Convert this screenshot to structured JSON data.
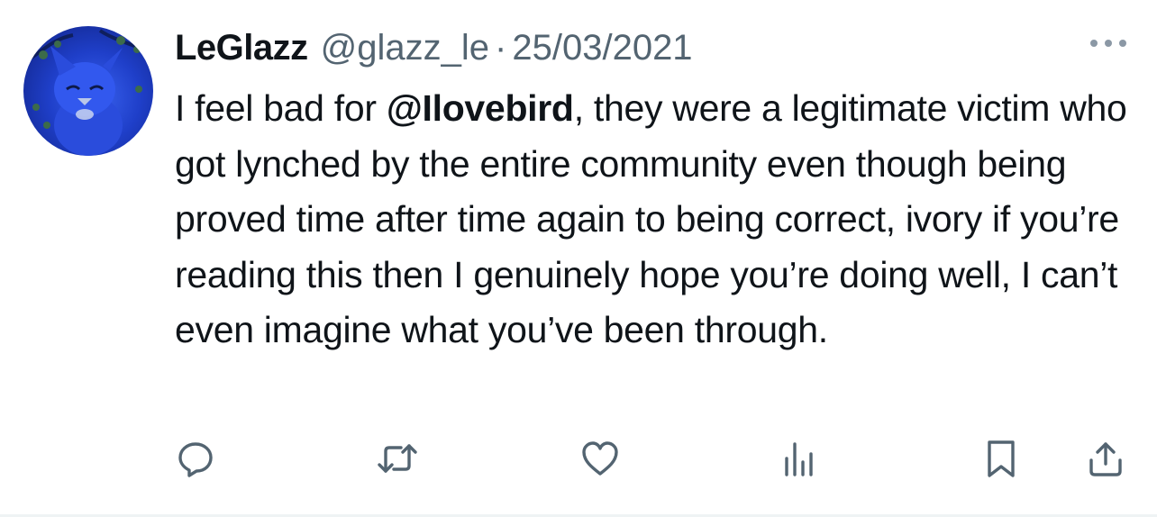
{
  "tweet": {
    "author_name": "LeGlazz",
    "author_handle": "@glazz_le",
    "separator": "·",
    "date": "25/03/2021",
    "text_before_mention": "I feel bad for ",
    "mention": "@Ilovebird",
    "text_after_mention": ", they were a legitimate victim who got lynched by the entire community even though being proved time after time again to being correct, ivory if you’re reading this then I genuinely hope you’re doing well, I can’t even imagine what you’ve been through."
  },
  "icons": {
    "more": "more-horizontal-icon",
    "reply": "reply-icon",
    "retweet": "retweet-icon",
    "like": "heart-icon",
    "views": "bar-chart-icon",
    "bookmark": "bookmark-icon",
    "share": "share-icon"
  },
  "colors": {
    "text_primary": "#0f1419",
    "text_secondary": "#536471",
    "icon_gray": "#536471",
    "avatar_blue": "#1f3fc9"
  }
}
